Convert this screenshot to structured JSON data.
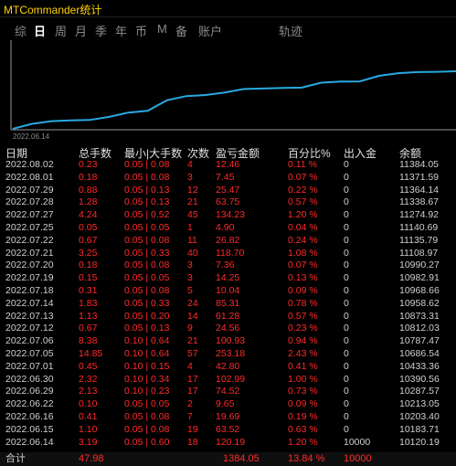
{
  "app": {
    "title": "MTCommander统计"
  },
  "tabs": [
    {
      "label": "综",
      "active": false
    },
    {
      "label": "日",
      "active": true
    },
    {
      "label": "周",
      "active": false
    },
    {
      "label": "月",
      "active": false
    },
    {
      "label": "季",
      "active": false
    },
    {
      "label": "年",
      "active": false
    },
    {
      "label": "币",
      "active": false
    },
    {
      "label": "M",
      "active": false
    },
    {
      "label": "备",
      "active": false
    },
    {
      "label": "账户",
      "active": false
    },
    {
      "label": "轨迹",
      "active": false
    }
  ],
  "chart": {
    "start_label": "2022.06.14",
    "line_color": "#29a9e0"
  },
  "headers": {
    "date": "日期",
    "total_lots": "总手数",
    "min_max_lots": "最小|大手数",
    "count": "次数",
    "profit": "盈亏金额",
    "percent": "百分比%",
    "inout": "出入金",
    "balance": "余额"
  },
  "rows": [
    {
      "date": "2022.08.02",
      "lots": "0.23",
      "range": "0.05 | 0.08",
      "count": "4",
      "pl": "12.46",
      "pct": "0.11 %",
      "io": "0",
      "bal": "11384.05"
    },
    {
      "date": "2022.08.01",
      "lots": "0.18",
      "range": "0.05 | 0.08",
      "count": "3",
      "pl": "7.45",
      "pct": "0.07 %",
      "io": "0",
      "bal": "11371.59"
    },
    {
      "date": "2022.07.29",
      "lots": "0.88",
      "range": "0.05 | 0.13",
      "count": "12",
      "pl": "25.47",
      "pct": "0.22 %",
      "io": "0",
      "bal": "11364.14"
    },
    {
      "date": "2022.07.28",
      "lots": "1.28",
      "range": "0.05 | 0.13",
      "count": "21",
      "pl": "63.75",
      "pct": "0.57 %",
      "io": "0",
      "bal": "11338.67"
    },
    {
      "date": "2022.07.27",
      "lots": "4.24",
      "range": "0.05 | 0.52",
      "count": "45",
      "pl": "134.23",
      "pct": "1.20 %",
      "io": "0",
      "bal": "11274.92"
    },
    {
      "date": "2022.07.25",
      "lots": "0.05",
      "range": "0.05 | 0.05",
      "count": "1",
      "pl": "4.90",
      "pct": "0.04 %",
      "io": "0",
      "bal": "11140.69"
    },
    {
      "date": "2022.07.22",
      "lots": "0.67",
      "range": "0.05 | 0.08",
      "count": "11",
      "pl": "26.82",
      "pct": "0.24 %",
      "io": "0",
      "bal": "11135.79"
    },
    {
      "date": "2022.07.21",
      "lots": "3.25",
      "range": "0.05 | 0.33",
      "count": "40",
      "pl": "118.70",
      "pct": "1.08 %",
      "io": "0",
      "bal": "11108.97"
    },
    {
      "date": "2022.07.20",
      "lots": "0.18",
      "range": "0.05 | 0.08",
      "count": "3",
      "pl": "7.36",
      "pct": "0.07 %",
      "io": "0",
      "bal": "10990.27"
    },
    {
      "date": "2022.07.19",
      "lots": "0.15",
      "range": "0.05 | 0.05",
      "count": "3",
      "pl": "14.25",
      "pct": "0.13 %",
      "io": "0",
      "bal": "10982.91"
    },
    {
      "date": "2022.07.18",
      "lots": "0.31",
      "range": "0.05 | 0.08",
      "count": "5",
      "pl": "10.04",
      "pct": "0.09 %",
      "io": "0",
      "bal": "10968.66"
    },
    {
      "date": "2022.07.14",
      "lots": "1.83",
      "range": "0.05 | 0.33",
      "count": "24",
      "pl": "85.31",
      "pct": "0.78 %",
      "io": "0",
      "bal": "10958.62"
    },
    {
      "date": "2022.07.13",
      "lots": "1.13",
      "range": "0.05 | 0.20",
      "count": "14",
      "pl": "61.28",
      "pct": "0.57 %",
      "io": "0",
      "bal": "10873.31"
    },
    {
      "date": "2022.07.12",
      "lots": "0.67",
      "range": "0.05 | 0.13",
      "count": "9",
      "pl": "24.56",
      "pct": "0.23 %",
      "io": "0",
      "bal": "10812.03"
    },
    {
      "date": "2022.07.06",
      "lots": "8.38",
      "range": "0.10 | 0.64",
      "count": "21",
      "pl": "100.93",
      "pct": "0.94 %",
      "io": "0",
      "bal": "10787.47"
    },
    {
      "date": "2022.07.05",
      "lots": "14.85",
      "range": "0.10 | 0.64",
      "count": "57",
      "pl": "253.18",
      "pct": "2.43 %",
      "io": "0",
      "bal": "10686.54"
    },
    {
      "date": "2022.07.01",
      "lots": "0.45",
      "range": "0.10 | 0.15",
      "count": "4",
      "pl": "42.80",
      "pct": "0.41 %",
      "io": "0",
      "bal": "10433.36"
    },
    {
      "date": "2022.06.30",
      "lots": "2.32",
      "range": "0.10 | 0.34",
      "count": "17",
      "pl": "102.99",
      "pct": "1.00 %",
      "io": "0",
      "bal": "10390.56"
    },
    {
      "date": "2022.06.29",
      "lots": "2.13",
      "range": "0.10 | 0.23",
      "count": "17",
      "pl": "74.52",
      "pct": "0.73 %",
      "io": "0",
      "bal": "10287.57"
    },
    {
      "date": "2022.06.22",
      "lots": "0.10",
      "range": "0.05 | 0.05",
      "count": "2",
      "pl": "9.65",
      "pct": "0.09 %",
      "io": "0",
      "bal": "10213.05"
    },
    {
      "date": "2022.06.16",
      "lots": "0.41",
      "range": "0.05 | 0.08",
      "count": "7",
      "pl": "19.69",
      "pct": "0.19 %",
      "io": "0",
      "bal": "10203.40"
    },
    {
      "date": "2022.06.15",
      "lots": "1.10",
      "range": "0.05 | 0.08",
      "count": "19",
      "pl": "63.52",
      "pct": "0.63 %",
      "io": "0",
      "bal": "10183.71"
    },
    {
      "date": "2022.06.14",
      "lots": "3.19",
      "range": "0.05 | 0.60",
      "count": "18",
      "pl": "120.19",
      "pct": "1.20 %",
      "io": "10000",
      "bal": "10120.19"
    }
  ],
  "totals": {
    "label": "合计",
    "lots": "47.98",
    "pl": "1384.05",
    "pct": "13.84 %",
    "io": "10000"
  }
}
